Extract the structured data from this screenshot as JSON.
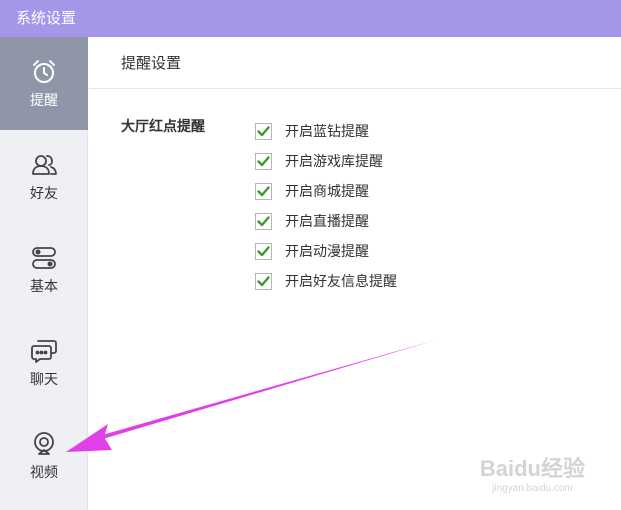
{
  "window": {
    "title": "系统设置"
  },
  "sidebar": {
    "items": [
      {
        "label": "提醒",
        "icon": "alarm-clock-icon",
        "active": true
      },
      {
        "label": "好友",
        "icon": "friends-icon",
        "active": false
      },
      {
        "label": "基本",
        "icon": "toggles-icon",
        "active": false
      },
      {
        "label": "聊天",
        "icon": "chat-icon",
        "active": false
      },
      {
        "label": "视频",
        "icon": "webcam-icon",
        "active": false
      }
    ]
  },
  "main": {
    "header": "提醒设置",
    "group_label": "大厅红点提醒",
    "options": [
      {
        "label": "开启蓝钻提醒",
        "checked": true
      },
      {
        "label": "开启游戏库提醒",
        "checked": true
      },
      {
        "label": "开启商城提醒",
        "checked": true
      },
      {
        "label": "开启直播提醒",
        "checked": true
      },
      {
        "label": "开启动漫提醒",
        "checked": true
      },
      {
        "label": "开启好友信息提醒",
        "checked": true
      }
    ]
  },
  "watermark": {
    "main": "Baidu经验",
    "sub": "jingyan.baidu.com"
  },
  "colors": {
    "titlebar": "#a696ea",
    "sidebar_bg": "#eef0f4",
    "sidebar_active": "#8e96a8",
    "check": "#3a9a2e",
    "arrow": "#e040e8"
  }
}
